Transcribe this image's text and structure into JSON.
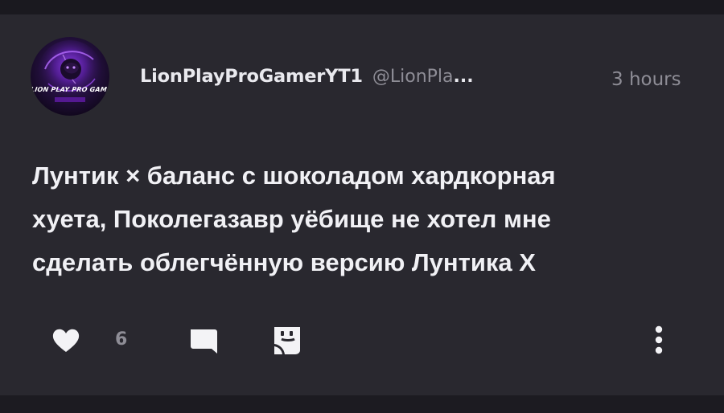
{
  "post": {
    "avatar_text": "LION PLAY PRO GAMER",
    "username": "LionPlayProGamerYT1",
    "handle": "@LionPla",
    "handle_ellipsis": "...",
    "time": "3 hours",
    "text_lines": [
      "Лунтик × баланс с шоколадом хардкорная",
      "хуета, Поколегазавр уёбище не хотел мне",
      "сделать облегчённую версию Лунтика Х"
    ]
  },
  "actions": {
    "like_icon": "heart-icon",
    "like_count": "6",
    "reply_icon": "comment-icon",
    "remix_icon": "remix-icon",
    "more_icon": "more-vertical-icon"
  },
  "colors": {
    "background": "#1d1c22",
    "card": "#29282f",
    "text_primary": "#f1f1f5",
    "text_secondary": "#8e8d96",
    "avatar_glow": "#7b2fd0"
  }
}
